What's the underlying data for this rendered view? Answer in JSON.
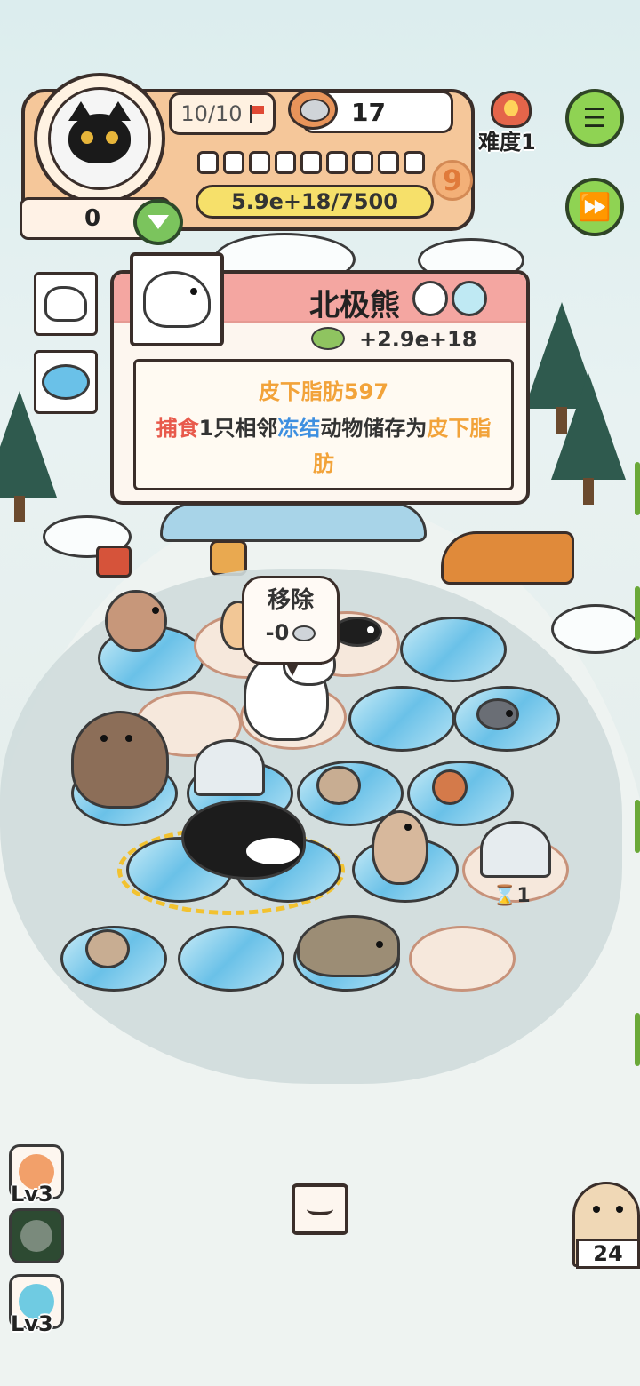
{
  "hud": {
    "lives": "10/10",
    "food_count": "17",
    "level": "9",
    "xp": "5.9e+18/7500",
    "coins": "0",
    "difficulty": "难度1",
    "pips_total": 10
  },
  "popup": {
    "title": "北极熊",
    "income": "+2.9e+18",
    "skill_name": "皮下脂肪597",
    "skill_desc_parts": {
      "a": "捕食",
      "b": "1只相邻",
      "c": "冻结",
      "d": "动物储存为",
      "e": "皮下脂肪"
    }
  },
  "remove_bubble": {
    "label": "移除",
    "cost": "-0"
  },
  "hourglass": "1",
  "slots": [
    {
      "level": "Lv3",
      "color": "#f2a06a"
    },
    {
      "level": "",
      "color": "#2d4a32"
    },
    {
      "level": "Lv3",
      "color": "#6fcbe2"
    }
  ],
  "owl_count": "24",
  "icons": {
    "menu": "menu-icon",
    "fast_forward": "fast-forward-icon",
    "flag": "flag-icon",
    "heart": "heart-icon"
  }
}
